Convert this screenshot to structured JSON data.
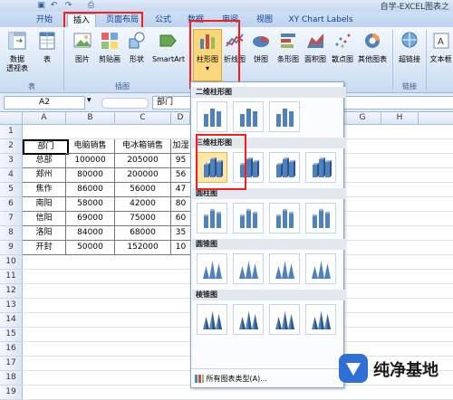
{
  "window": {
    "title": "自学-EXCEL图表之"
  },
  "tabs": [
    {
      "label": "开始"
    },
    {
      "label": "插入"
    },
    {
      "label": "页面布局"
    },
    {
      "label": "公式"
    },
    {
      "label": "数据"
    },
    {
      "label": "审阅"
    },
    {
      "label": "视图"
    },
    {
      "label": "XY Chart Labels"
    }
  ],
  "ribbon": {
    "pivot": "数据\n透视表",
    "table": "表",
    "picture": "图片",
    "clipart": "剪贴画",
    "shapes": "形状",
    "smartart": "SmartArt",
    "column": "柱形图",
    "line": "折线图",
    "pie": "饼图",
    "bar": "条形图",
    "area": "面积图",
    "scatter": "散点图",
    "other": "其他图表",
    "hyperlink": "超链接",
    "textbox": "文本框",
    "group_tables": "表",
    "group_illustrations": "插图",
    "group_links": "链接"
  },
  "formula_bar": {
    "name_box": "A2",
    "fx": "fx",
    "content": "部门"
  },
  "columns": [
    "A",
    "B",
    "C",
    "D",
    "G",
    "H"
  ],
  "rows": [
    "1",
    "2",
    "3",
    "4",
    "5",
    "6",
    "7",
    "8",
    "9",
    "10",
    "11",
    "12",
    "13",
    "14",
    "15",
    "16",
    "17",
    "18",
    "19"
  ],
  "table": {
    "headers": [
      "部门",
      "电脑销售",
      "电冰箱销售",
      "加湿"
    ],
    "rows": [
      [
        "总部",
        "100000",
        "205000",
        "95"
      ],
      [
        "郑州",
        "80000",
        "200000",
        "56"
      ],
      [
        "焦作",
        "86000",
        "56000",
        "47"
      ],
      [
        "南阳",
        "58000",
        "42000",
        "80"
      ],
      [
        "信阳",
        "69000",
        "75000",
        "60"
      ],
      [
        "洛阳",
        "84000",
        "68000",
        "35"
      ],
      [
        "开封",
        "50000",
        "152000",
        "10"
      ]
    ]
  },
  "dropdown": {
    "sections": [
      "二维柱形图",
      "三维柱形图",
      "圆柱图",
      "圆锥图",
      "棱锥图"
    ],
    "all_types": "所有图表类型(A)..."
  },
  "watermark": {
    "text": "纯净基地"
  },
  "colors": {
    "highlight": "#ff1a1a",
    "ribbon_text": "#15428b",
    "bar_blue": "#4f81bd"
  }
}
